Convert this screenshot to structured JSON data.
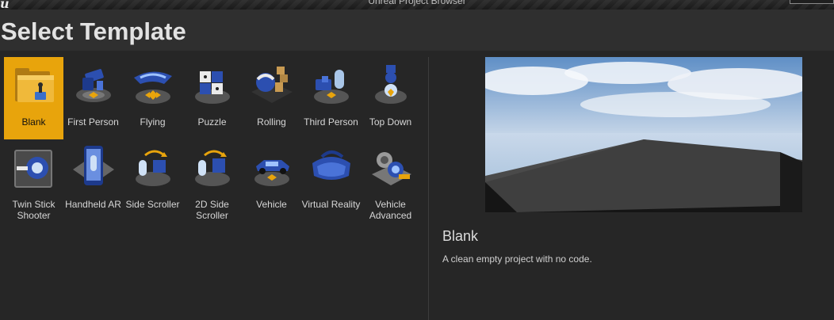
{
  "window": {
    "title": "Unreal Project Browser",
    "logo": "u"
  },
  "page_title": "Select Template",
  "templates": [
    {
      "label": "Blank",
      "icon": "folder-icon",
      "selected": true
    },
    {
      "label": "First Person",
      "icon": "first-person-icon"
    },
    {
      "label": "Flying",
      "icon": "flying-icon"
    },
    {
      "label": "Puzzle",
      "icon": "puzzle-icon"
    },
    {
      "label": "Rolling",
      "icon": "rolling-icon"
    },
    {
      "label": "Third Person",
      "icon": "third-person-icon"
    },
    {
      "label": "Top Down",
      "icon": "top-down-icon"
    },
    {
      "label": "Twin Stick Shooter",
      "icon": "twin-stick-icon"
    },
    {
      "label": "Handheld AR",
      "icon": "handheld-ar-icon"
    },
    {
      "label": "Side Scroller",
      "icon": "side-scroller-icon"
    },
    {
      "label": "2D Side Scroller",
      "icon": "2d-side-scroller-icon"
    },
    {
      "label": "Vehicle",
      "icon": "vehicle-icon"
    },
    {
      "label": "Virtual Reality",
      "icon": "vr-headset-icon"
    },
    {
      "label": "Vehicle Advanced",
      "icon": "vehicle-advanced-icon"
    }
  ],
  "details": {
    "name": "Blank",
    "description": "A clean empty project with no code."
  },
  "colors": {
    "selected": "#e8a40c",
    "background": "#262626",
    "header": "#2f2f2f"
  }
}
